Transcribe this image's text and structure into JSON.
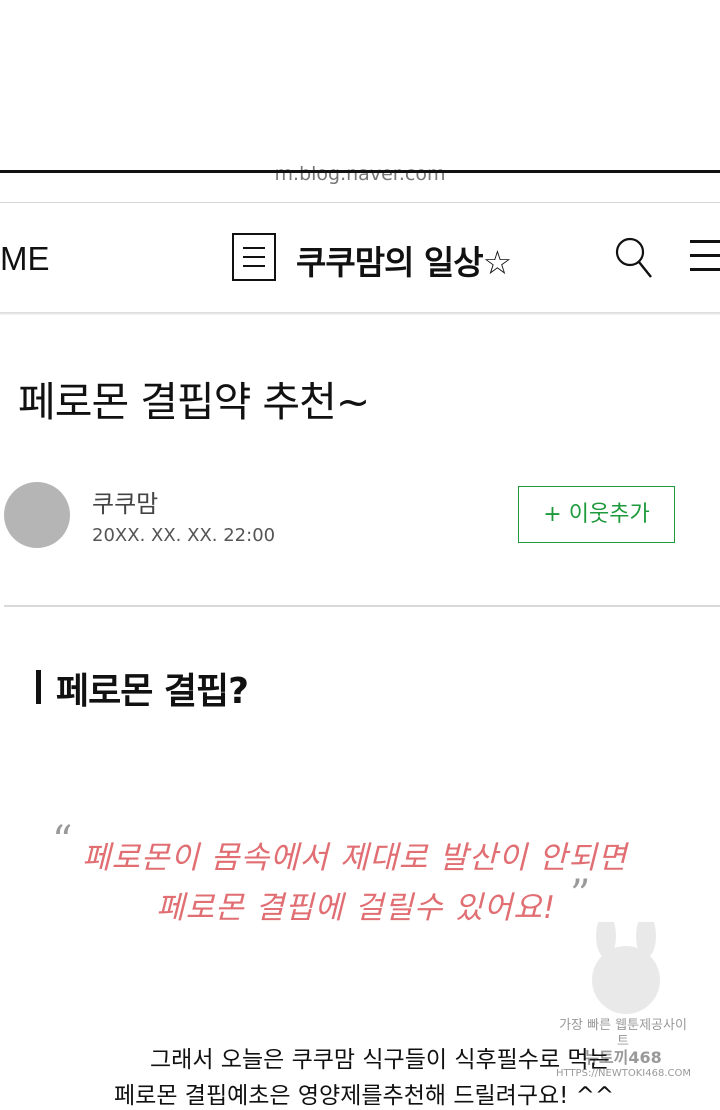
{
  "browser": {
    "url": "m.blog.naver.com"
  },
  "header": {
    "home_label": "ME",
    "blog_title": "쿠쿠맘의 일상☆",
    "icons": {
      "menu": "list-menu-icon",
      "search": "search-icon",
      "more": "hamburger-icon"
    }
  },
  "post": {
    "title": "페로몬 결핍약 추천~",
    "author": "쿠쿠맘",
    "date": "20XX. XX. XX. 22:00",
    "neighbor_button": "+ 이웃추가"
  },
  "content": {
    "section_title": "페로몬 결핍?",
    "quote_open": "“",
    "quote_close": "”",
    "quote_lines": [
      "페로몬이 몸속에서 제대로 발산이 안되면",
      "페로몬 결핍에 걸릴수 있어요!"
    ],
    "body_lines": [
      "그래서 오늘은 쿠쿠맘 식구들이 식후필수로 먹는",
      "페로몬 결핍예초은 영양제를추천해 드릴려구요! ^^"
    ]
  },
  "watermark": {
    "lines": [
      "가장 빠른 웹툰제공사이트",
      "뉴토끼468",
      "HTTPS://NEWTOKI468.COM"
    ]
  },
  "colors": {
    "accent_green": "#1e9a3c",
    "quote_pink": "#e06e72"
  }
}
